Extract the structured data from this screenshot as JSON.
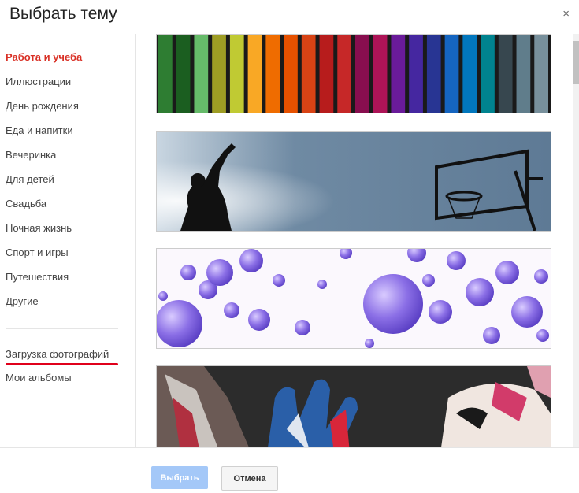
{
  "dialog": {
    "title": "Выбрать тему",
    "close": "×"
  },
  "sidebar": {
    "items": [
      {
        "label": "Работа и учеба"
      },
      {
        "label": "Иллюстрации"
      },
      {
        "label": "День рождения"
      },
      {
        "label": "Еда и напитки"
      },
      {
        "label": "Вечеринка"
      },
      {
        "label": "Для детей"
      },
      {
        "label": "Свадьба"
      },
      {
        "label": "Ночная жизнь"
      },
      {
        "label": "Спорт и игры"
      },
      {
        "label": "Путешествия"
      },
      {
        "label": "Другие"
      }
    ],
    "upload": "Загрузка фотографий",
    "albums": "Мои альбомы"
  },
  "footer": {
    "select": "Выбрать",
    "cancel": "Отмена"
  },
  "colors": {
    "active": "#d93025",
    "primary_disabled": "#a4c8f8",
    "underline": "#e0001b"
  }
}
